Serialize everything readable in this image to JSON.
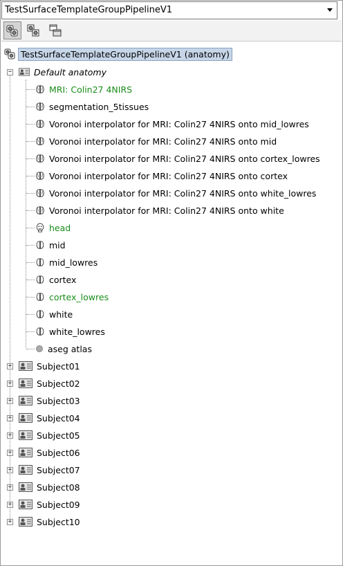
{
  "combo": {
    "value": "TestSurfaceTemplateGroupPipelineV1"
  },
  "toolbar": {
    "buttons": [
      {
        "name": "view-tree-icon",
        "active": true
      },
      {
        "name": "view-group-icon",
        "active": false
      },
      {
        "name": "view-window-icon",
        "active": false
      }
    ]
  },
  "tree": {
    "root": {
      "label": "TestSurfaceTemplateGroupPipelineV1 (anatomy)"
    },
    "default_anatomy": {
      "label": "Default anatomy"
    },
    "anatomy_items": [
      {
        "label": "MRI: Colin27 4NIRS",
        "icon": "mri-icon",
        "green": true
      },
      {
        "label": "segmentation_5tissues",
        "icon": "mri-icon",
        "green": false
      },
      {
        "label": "Voronoi interpolator for MRI: Colin27 4NIRS onto mid_lowres",
        "icon": "mri-icon",
        "green": false
      },
      {
        "label": "Voronoi interpolator for MRI: Colin27 4NIRS onto mid",
        "icon": "mri-icon",
        "green": false
      },
      {
        "label": "Voronoi interpolator for MRI: Colin27 4NIRS onto cortex_lowres",
        "icon": "mri-icon",
        "green": false
      },
      {
        "label": "Voronoi interpolator for MRI: Colin27 4NIRS onto cortex",
        "icon": "mri-icon",
        "green": false
      },
      {
        "label": "Voronoi interpolator for MRI: Colin27 4NIRS onto white_lowres",
        "icon": "mri-icon",
        "green": false
      },
      {
        "label": "Voronoi interpolator for MRI: Colin27 4NIRS onto white",
        "icon": "mri-icon",
        "green": false
      },
      {
        "label": "head",
        "icon": "head-icon",
        "green": true
      },
      {
        "label": "mid",
        "icon": "cortex-icon",
        "green": false
      },
      {
        "label": "mid_lowres",
        "icon": "cortex-icon",
        "green": false
      },
      {
        "label": "cortex",
        "icon": "cortex-icon",
        "green": false
      },
      {
        "label": "cortex_lowres",
        "icon": "cortex-icon",
        "green": true
      },
      {
        "label": "white",
        "icon": "cortex-icon",
        "green": false
      },
      {
        "label": "white_lowres",
        "icon": "cortex-icon",
        "green": false
      },
      {
        "label": "aseg atlas",
        "icon": "atlas-icon",
        "green": false
      }
    ],
    "subjects": [
      {
        "label": "Subject01"
      },
      {
        "label": "Subject02"
      },
      {
        "label": "Subject03"
      },
      {
        "label": "Subject04"
      },
      {
        "label": "Subject05"
      },
      {
        "label": "Subject06"
      },
      {
        "label": "Subject07"
      },
      {
        "label": "Subject08"
      },
      {
        "label": "Subject09"
      },
      {
        "label": "Subject10"
      }
    ]
  },
  "colors": {
    "selection": "#c6d6e8",
    "green_text": "#1a8c1a"
  }
}
